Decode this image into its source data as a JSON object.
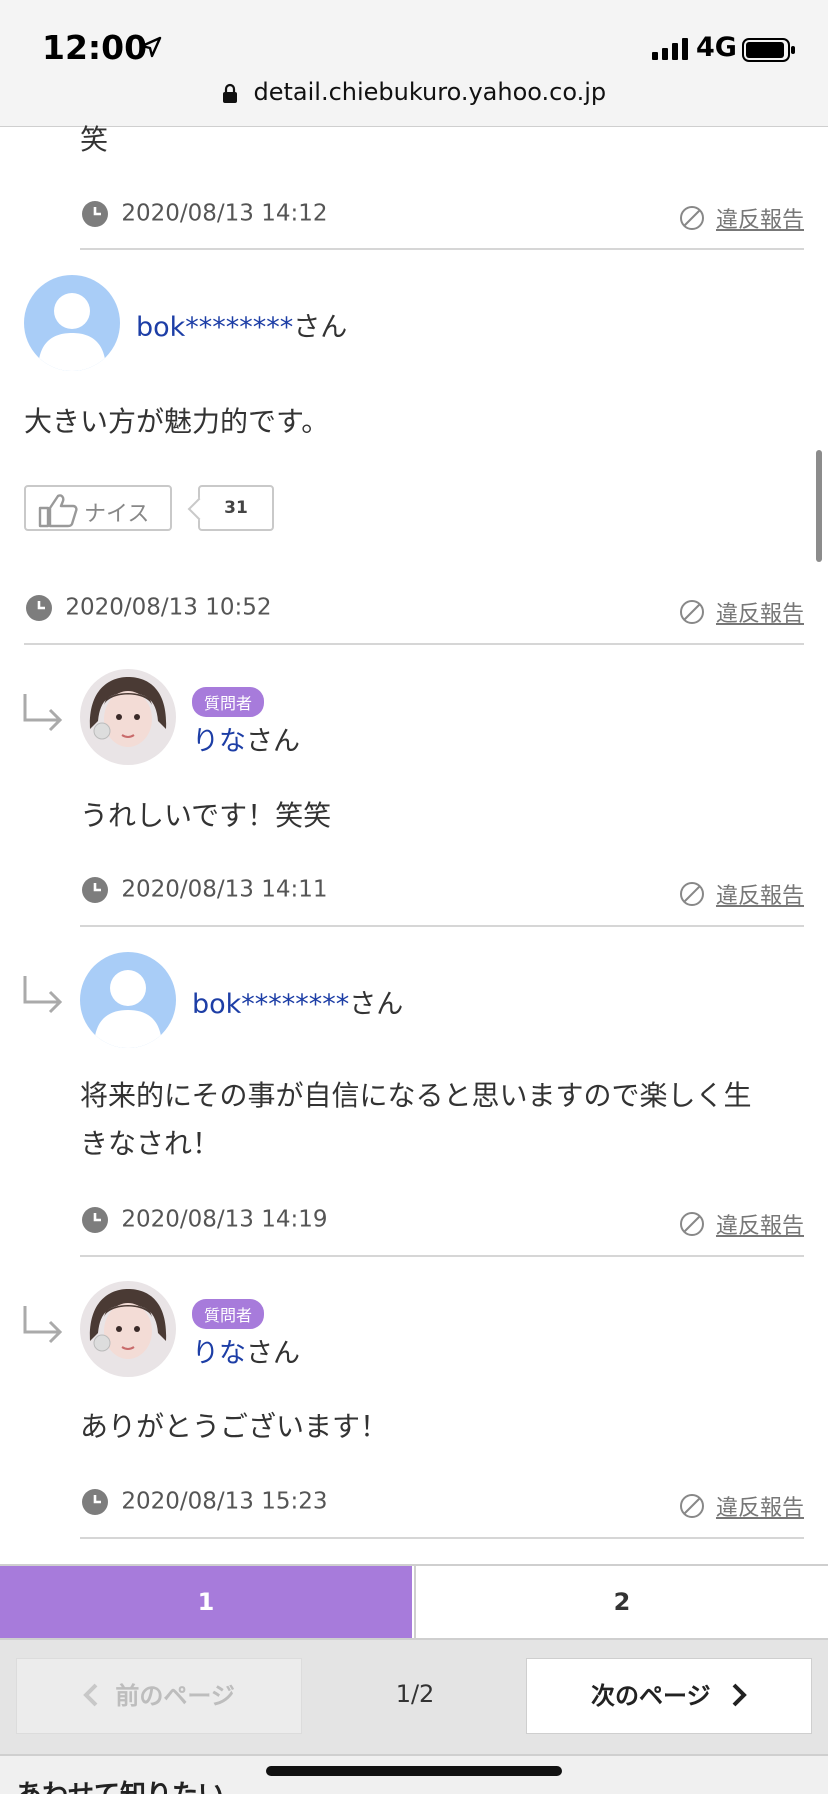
{
  "status_bar": {
    "time": "12:00",
    "network": "4G",
    "url": "detail.chiebukuro.yahoo.co.jp"
  },
  "top_fragment": {
    "text": "笑",
    "date": "2020/08/13 14:12",
    "report": "違反報告"
  },
  "answer": {
    "handle": "bok********",
    "suffix": "さん",
    "text": "大きい方が魅力的です。",
    "nice_label": "ナイス",
    "nice_count": "31",
    "date": "2020/08/13 10:52",
    "report": "違反報告"
  },
  "replies": [
    {
      "badge": "質問者",
      "handle": "りな",
      "suffix": "さん",
      "text": "うれしいです！笑笑",
      "date": "2020/08/13 14:11",
      "report": "違反報告"
    },
    {
      "handle": "bok********",
      "suffix": "さん",
      "text_line1": "将来的にその事が自信になると思いますので楽しく生",
      "text_line2": "きなされ！",
      "date": "2020/08/13 14:19",
      "report": "違反報告"
    },
    {
      "badge": "質問者",
      "handle": "りな",
      "suffix": "さん",
      "text": "ありがとうございます！",
      "date": "2020/08/13 15:23",
      "report": "違反報告"
    }
  ],
  "pagination": {
    "tabs": [
      "1",
      "2"
    ],
    "prev_label": "前のページ",
    "indicator": "1/2",
    "next_label": "次のページ"
  },
  "footer_peek": "あわせて知りたい",
  "colors": {
    "accent": "#a77bdb",
    "link": "#1d3ea6",
    "avatar_default": "#a9cdf7"
  }
}
